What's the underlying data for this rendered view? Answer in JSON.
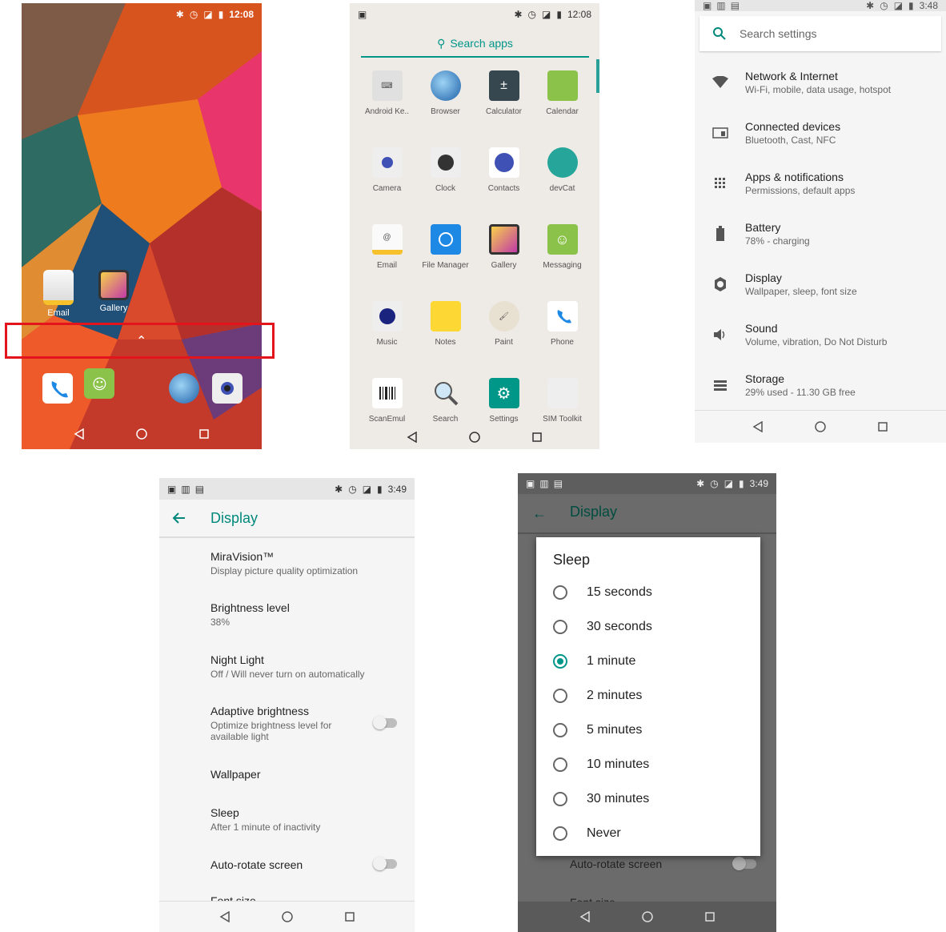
{
  "home": {
    "time": "12:08",
    "apps": [
      {
        "label": "Email"
      },
      {
        "label": "Gallery"
      }
    ],
    "up_arrow": "⌃"
  },
  "drawer": {
    "time": "12:08",
    "search_label": "Search apps",
    "apps": [
      {
        "label": "Android Ke.."
      },
      {
        "label": "Browser"
      },
      {
        "label": "Calculator"
      },
      {
        "label": "Calendar"
      },
      {
        "label": "Camera"
      },
      {
        "label": "Clock"
      },
      {
        "label": "Contacts"
      },
      {
        "label": "devCat"
      },
      {
        "label": "Email"
      },
      {
        "label": "File Manager"
      },
      {
        "label": "Gallery"
      },
      {
        "label": "Messaging"
      },
      {
        "label": "Music"
      },
      {
        "label": "Notes"
      },
      {
        "label": "Paint"
      },
      {
        "label": "Phone"
      },
      {
        "label": "ScanEmul"
      },
      {
        "label": "Search"
      },
      {
        "label": "Settings"
      },
      {
        "label": "SIM Toolkit"
      }
    ]
  },
  "settings": {
    "time": "3:48",
    "search_placeholder": "Search settings",
    "items": [
      {
        "title": "Network & Internet",
        "subtitle": "Wi-Fi, mobile, data usage, hotspot",
        "icon": "wifi-icon"
      },
      {
        "title": "Connected devices",
        "subtitle": "Bluetooth, Cast, NFC",
        "icon": "devices-icon"
      },
      {
        "title": "Apps & notifications",
        "subtitle": "Permissions, default apps",
        "icon": "apps-icon"
      },
      {
        "title": "Battery",
        "subtitle": "78% - charging",
        "icon": "battery-icon"
      },
      {
        "title": "Display",
        "subtitle": "Wallpaper, sleep, font size",
        "icon": "brightness-icon"
      },
      {
        "title": "Sound",
        "subtitle": "Volume, vibration, Do Not Disturb",
        "icon": "volume-icon"
      },
      {
        "title": "Storage",
        "subtitle": "29% used - 11.30 GB free",
        "icon": "storage-icon"
      }
    ]
  },
  "display": {
    "time": "3:49",
    "title": "Display",
    "items": [
      {
        "title": "MiraVision™",
        "subtitle": "Display picture quality optimization"
      },
      {
        "title": "Brightness level",
        "subtitle": "38%"
      },
      {
        "title": "Night Light",
        "subtitle": "Off / Will never turn on automatically"
      },
      {
        "title": "Adaptive brightness",
        "subtitle": "Optimize brightness level for available light"
      },
      {
        "title": "Wallpaper",
        "subtitle": ""
      },
      {
        "title": "Sleep",
        "subtitle": "After 1 minute of inactivity"
      },
      {
        "title": "Auto-rotate screen",
        "subtitle": ""
      },
      {
        "title": "Font size",
        "subtitle": ""
      }
    ]
  },
  "sleep_dialog": {
    "time": "3:49",
    "screen_title": "Display",
    "title": "Sleep",
    "options": [
      "15 seconds",
      "30 seconds",
      "1 minute",
      "2 minutes",
      "5 minutes",
      "10 minutes",
      "30 minutes",
      "Never"
    ],
    "selected": "1 minute",
    "behind": [
      "Auto-rotate screen",
      "Font size"
    ]
  },
  "colors": {
    "accent": "#009688",
    "highlight": "#e3141b"
  }
}
